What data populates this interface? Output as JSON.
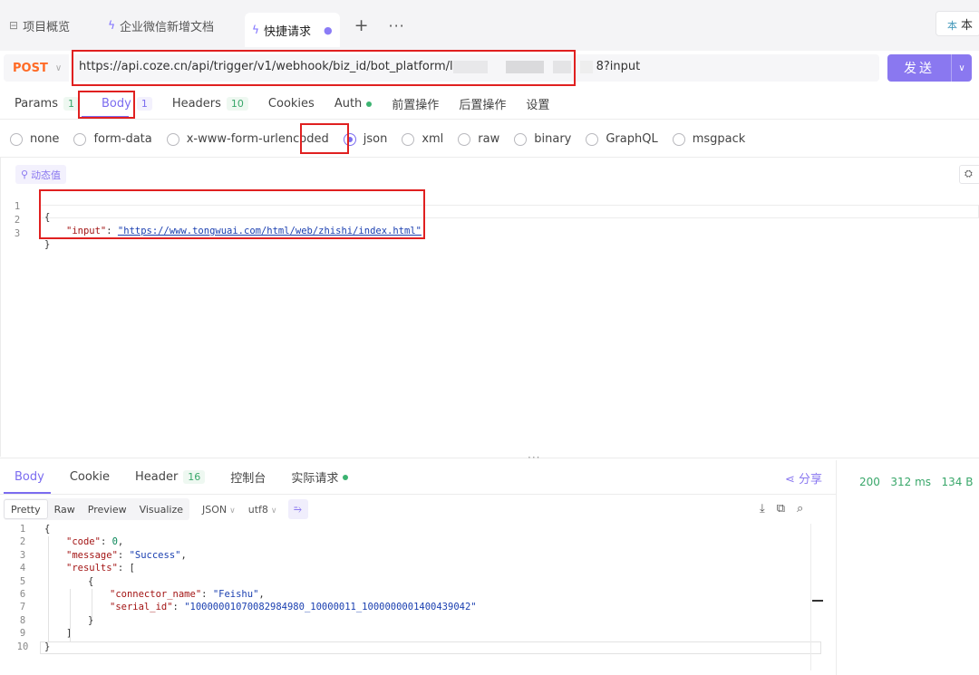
{
  "tabs": [
    {
      "icon": "layout-icon",
      "label": "项目概览"
    },
    {
      "icon": "bolt-icon",
      "label": "企业微信新增文档"
    },
    {
      "icon": "bolt-icon",
      "label": "快捷请求",
      "active": true
    }
  ],
  "tabbar": {
    "plus": "+",
    "more": "···",
    "right_mini": "本",
    "right_label": "本"
  },
  "request": {
    "method": "POST",
    "url_prefix": "https://api.coze.cn/api/trigger/v1/webhook/biz_id/bot_platform/",
    "url_frag": "l",
    "url_suffix": "8?input",
    "send_label": "发送"
  },
  "request_tabs": [
    {
      "label": "Params",
      "badge": "1"
    },
    {
      "label": "Body",
      "badge": "1",
      "active": true
    },
    {
      "label": "Headers",
      "badge": "10"
    },
    {
      "label": "Cookies"
    },
    {
      "label": "Auth",
      "dot": true
    },
    {
      "label": "前置操作"
    },
    {
      "label": "后置操作"
    },
    {
      "label": "设置"
    }
  ],
  "body_types": [
    "none",
    "form-data",
    "x-www-form-urlencoded",
    "json",
    "xml",
    "raw",
    "binary",
    "GraphQL",
    "msgpack"
  ],
  "body_type_selected": "json",
  "dynamic_value": "动态值",
  "request_body": {
    "line_numbers": [
      "1",
      "2",
      "3"
    ],
    "open": "{",
    "key": "\"input\"",
    "colon": ": ",
    "value": "\"https://www.tongwuai.com/html/web/zhishi/index.html\"",
    "close": "}"
  },
  "response_tabs": [
    {
      "label": "Body",
      "active": true
    },
    {
      "label": "Cookie"
    },
    {
      "label": "Header",
      "badge": "16"
    },
    {
      "label": "控制台"
    },
    {
      "label": "实际请求",
      "dot": true
    }
  ],
  "share_label": "分享",
  "status": {
    "code": "200",
    "time": "312 ms",
    "size": "134 B"
  },
  "response_toolbar": {
    "formats": [
      "Pretty",
      "Raw",
      "Preview",
      "Visualize"
    ],
    "active_format": "Pretty",
    "lang": "JSON",
    "encoding": "utf8"
  },
  "response_body": {
    "line_numbers": [
      "1",
      "2",
      "3",
      "4",
      "5",
      "6",
      "7",
      "8",
      "9",
      "10"
    ],
    "code_key": "\"code\"",
    "code_val": "0",
    "message_key": "\"message\"",
    "message_val": "\"Success\"",
    "results_key": "\"results\"",
    "connector_key": "\"connector_name\"",
    "connector_val": "\"Feishu\"",
    "serial_key": "\"serial_id\"",
    "serial_val": "\"10000001070082984980_10000011_1000000001400439042\""
  },
  "colors": {
    "accent": "#7b6cf0",
    "method": "#ff6b26",
    "success": "#39a76a",
    "highlight": "#e02020"
  }
}
